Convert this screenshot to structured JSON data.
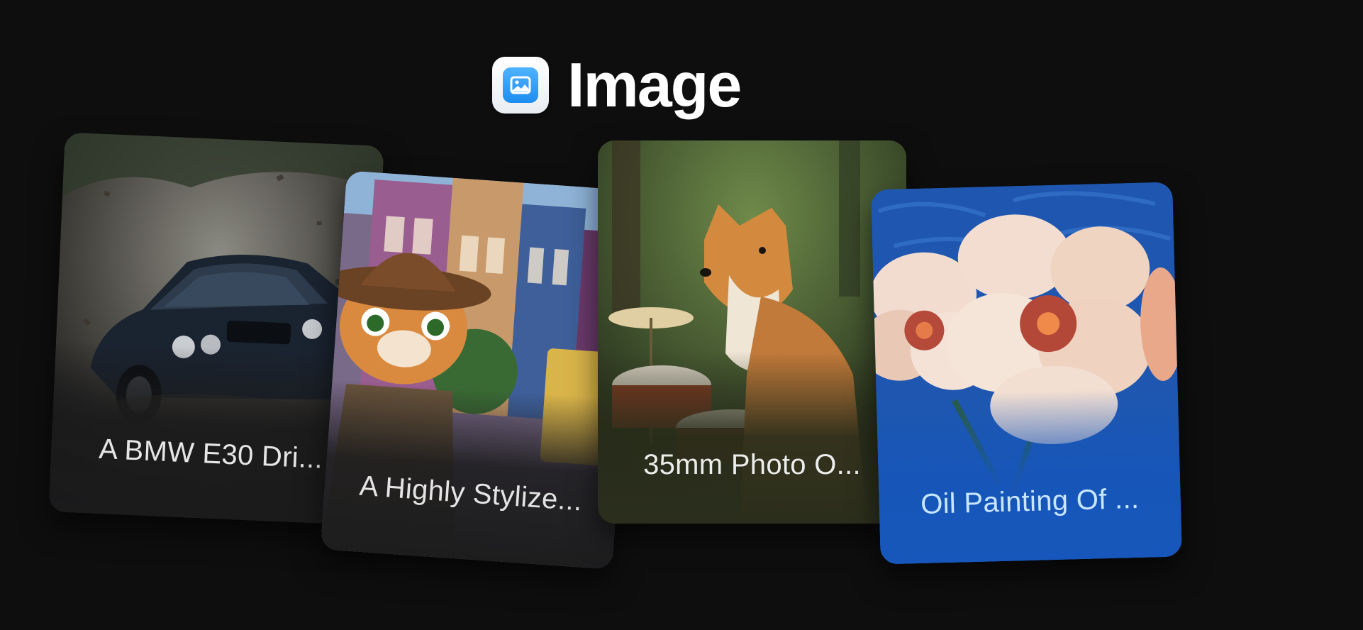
{
  "header": {
    "title": "Image",
    "icon": "image-icon"
  },
  "cards": [
    {
      "caption": "A BMW E30 Dri...",
      "icon": "car-photo"
    },
    {
      "caption": "A Highly Stylize...",
      "icon": "cat-illustration"
    },
    {
      "caption": "35mm Photo O...",
      "icon": "fox-photo"
    },
    {
      "caption": "Oil Painting Of ...",
      "icon": "flower-painting"
    }
  ],
  "colors": {
    "background": "#0e0e0f",
    "accent_blue": "#1f8df0",
    "painting_caption": "#c9e6ff"
  }
}
